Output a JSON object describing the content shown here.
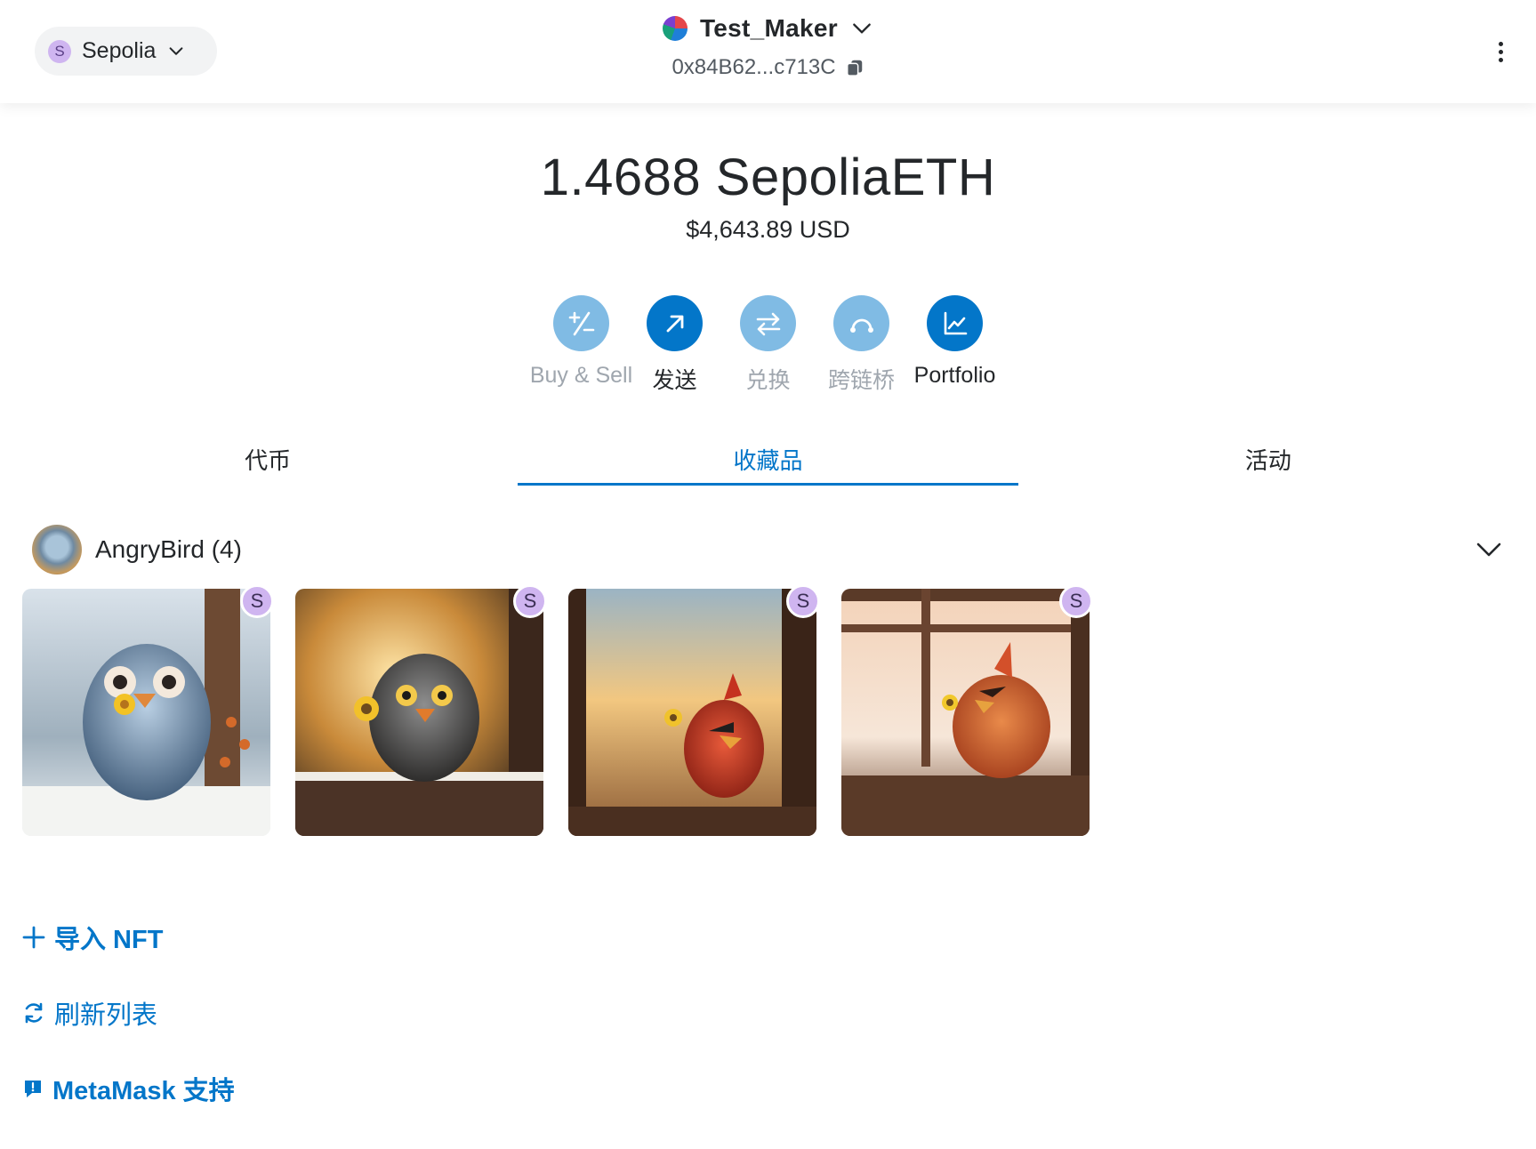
{
  "network": {
    "avatar_letter": "S",
    "name": "Sepolia"
  },
  "account": {
    "name": "Test_Maker",
    "address": "0x84B62...c713C"
  },
  "balance": {
    "main": "1.4688 SepoliaETH",
    "fiat": "$4,643.89 USD"
  },
  "actions": [
    {
      "label": "Buy & Sell",
      "icon": "plus-minus-icon",
      "enabled": false
    },
    {
      "label": "发送",
      "icon": "arrow-up-right-icon",
      "enabled": true
    },
    {
      "label": "兑换",
      "icon": "swap-icon",
      "enabled": false
    },
    {
      "label": "跨链桥",
      "icon": "bridge-icon",
      "enabled": false
    },
    {
      "label": "Portfolio",
      "icon": "chart-icon",
      "enabled": true
    }
  ],
  "tabs": [
    {
      "label": "代币",
      "active": false
    },
    {
      "label": "收藏品",
      "active": true
    },
    {
      "label": "活动",
      "active": false
    }
  ],
  "collection": {
    "title": "AngryBird (4)",
    "badge_letter": "S",
    "items": [
      {
        "badge": "S"
      },
      {
        "badge": "S"
      },
      {
        "badge": "S"
      },
      {
        "badge": "S"
      }
    ]
  },
  "links": {
    "import": "导入 NFT",
    "refresh": "刷新列表",
    "support": "MetaMask 支持"
  },
  "colors": {
    "accent": "#0376c9",
    "accent_disabled": "#80bbe4",
    "network_avatar": "#cfb5f0"
  }
}
